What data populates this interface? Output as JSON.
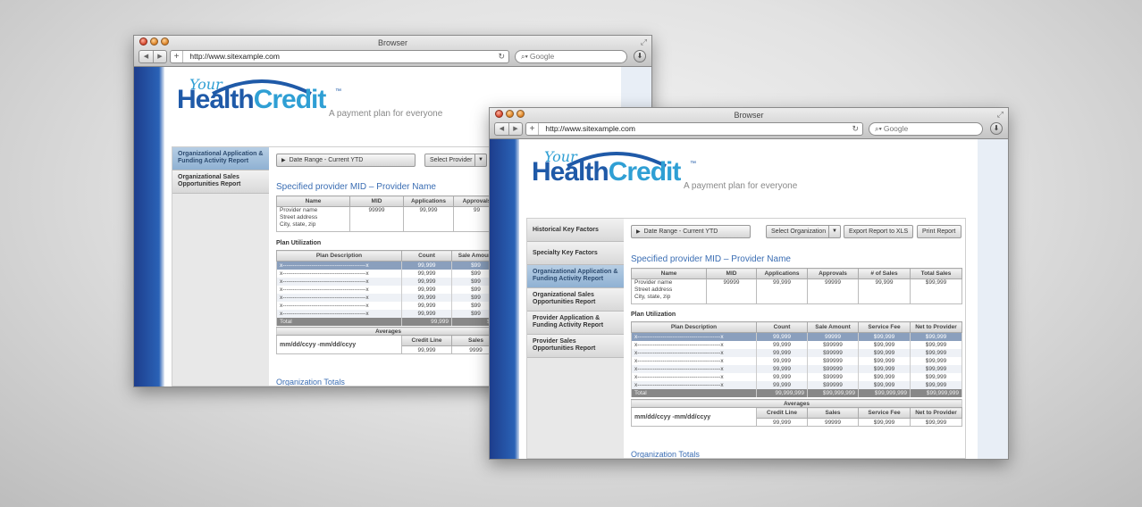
{
  "windows": [
    {
      "browser": {
        "title": "Browser",
        "url": "http://www.sitexample.com",
        "search_placeholder": "Google"
      },
      "logo": {
        "your": "Your",
        "brand_a": "Health",
        "brand_b": "Credit",
        "tm": "™"
      },
      "tagline": "A payment plan for everyone",
      "sidebar": [
        {
          "label": "Organizational Application & Funding Activity Report",
          "active": true
        },
        {
          "label": "Organizational Sales Opportunities Report",
          "active": false
        }
      ],
      "toolbar": {
        "date_range": "Date Range - Current YTD",
        "select": "Select Provider"
      },
      "page_title": "Specified provider MID – Provider Name",
      "provider_table": {
        "headers": [
          "Name",
          "MID",
          "Applications",
          "Approvals"
        ],
        "name_lines": [
          "Provider name",
          "Street address",
          "City, state, zip"
        ],
        "values": [
          "99999",
          "99,999",
          "99"
        ]
      },
      "plan_utilization": {
        "title": "Plan Utilization",
        "headers": [
          "Plan Description",
          "Count",
          "Sale Amount"
        ],
        "rows": [
          [
            "x-------------------------------------------x",
            "99,999",
            "$99"
          ],
          [
            "x-------------------------------------------x",
            "99,999",
            "$99"
          ],
          [
            "x-------------------------------------------x",
            "99,999",
            "$99"
          ],
          [
            "x-------------------------------------------x",
            "99,999",
            "$99"
          ],
          [
            "x-------------------------------------------x",
            "99,999",
            "$99"
          ],
          [
            "x-------------------------------------------x",
            "99,999",
            "$99"
          ],
          [
            "x-------------------------------------------x",
            "99,999",
            "$99"
          ]
        ],
        "total": [
          "Total",
          "99,999",
          "$99"
        ]
      },
      "averages": {
        "title": "Averages",
        "date": "mm/dd/ccyy -mm/dd/ccyy",
        "headers": [
          "Credit Line",
          "Sales"
        ],
        "values": [
          "99,999",
          "9999"
        ]
      },
      "org_totals": "Organization Totals"
    },
    {
      "browser": {
        "title": "Browser",
        "url": "http://www.sitexample.com",
        "search_placeholder": "Google"
      },
      "logo": {
        "your": "Your",
        "brand_a": "Health",
        "brand_b": "Credit",
        "tm": "™"
      },
      "tagline": "A payment plan for everyone",
      "sidebar": [
        {
          "label": "Historical Key Factors",
          "active": false
        },
        {
          "label": "Specialty Key Factors",
          "active": false
        },
        {
          "label": "Organizational Application & Funding Activity Report",
          "active": true
        },
        {
          "label": "Organizational Sales Opportunities Report",
          "active": false
        },
        {
          "label": "Provider Application & Funding Activity Report",
          "active": false
        },
        {
          "label": "Provider Sales Opportunities Report",
          "active": false
        }
      ],
      "toolbar": {
        "date_range": "Date Range - Current YTD",
        "select": "Select Organization",
        "export": "Export Report to XLS",
        "print": "Print Report"
      },
      "page_title": "Specified provider MID – Provider Name",
      "provider_table": {
        "headers": [
          "Name",
          "MID",
          "Applications",
          "Approvals",
          "# of Sales",
          "Total Sales"
        ],
        "name_lines": [
          "Provider name",
          "Street address",
          "City, state, zip"
        ],
        "values": [
          "99999",
          "99,999",
          "99999",
          "99,999",
          "$99,999"
        ]
      },
      "plan_utilization": {
        "title": "Plan Utilization",
        "headers": [
          "Plan Description",
          "Count",
          "Sale Amount",
          "Service Fee",
          "Net to Provider"
        ],
        "rows": [
          [
            "x-------------------------------------------x",
            "99,999",
            "99999",
            "$99,999",
            "$99,999"
          ],
          [
            "x-------------------------------------------x",
            "99,999",
            "$99999",
            "$99,999",
            "$99,999"
          ],
          [
            "x-------------------------------------------x",
            "99,999",
            "$99999",
            "$99,999",
            "$99,999"
          ],
          [
            "x-------------------------------------------x",
            "99,999",
            "$99999",
            "$99,999",
            "$99,999"
          ],
          [
            "x-------------------------------------------x",
            "99,999",
            "$99999",
            "$99,999",
            "$99,999"
          ],
          [
            "x-------------------------------------------x",
            "99,999",
            "$99999",
            "$99,999",
            "$99,999"
          ],
          [
            "x-------------------------------------------x",
            "99,999",
            "$99999",
            "$99,999",
            "$99,999"
          ]
        ],
        "total": [
          "Total",
          "99,999,999",
          "$99,999,999",
          "$99,999,999",
          "$99,999,999"
        ]
      },
      "averages": {
        "title": "Averages",
        "date": "mm/dd/ccyy -mm/dd/ccyy",
        "headers": [
          "Credit Line",
          "Sales",
          "Service Fee",
          "Net to Provider"
        ],
        "values": [
          "99,999",
          "99999",
          "$99,999",
          "$99,999"
        ]
      },
      "org_totals": "Organization Totals"
    }
  ]
}
